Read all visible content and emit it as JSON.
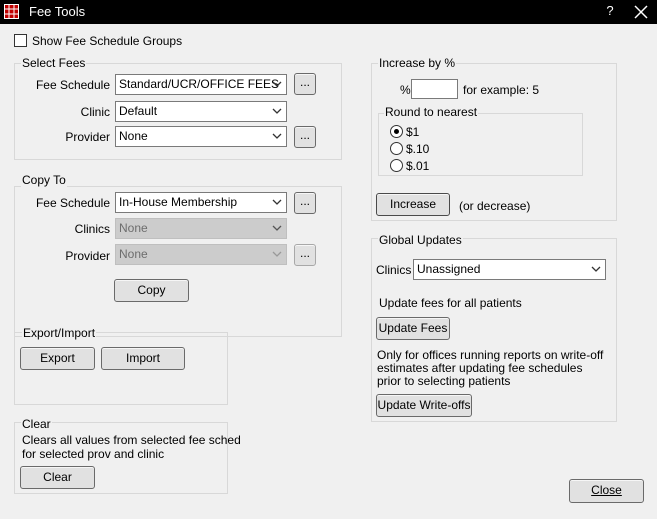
{
  "window": {
    "title": "Fee Tools",
    "help_glyph": "?",
    "close_icon": "close-icon"
  },
  "top": {
    "show_groups_label": "Show Fee Schedule Groups",
    "show_groups_checked": false
  },
  "select_fees": {
    "title": "Select Fees",
    "fee_schedule_label": "Fee Schedule",
    "fee_schedule_value": "Standard/UCR/OFFICE FEES",
    "clinic_label": "Clinic",
    "clinic_value": "Default",
    "provider_label": "Provider",
    "provider_value": "None",
    "ellipsis": "..."
  },
  "copy_to": {
    "title": "Copy To",
    "fee_schedule_label": "Fee Schedule",
    "fee_schedule_value": "In-House Membership",
    "clinics_label": "Clinics",
    "clinics_value": "None",
    "provider_label": "Provider",
    "provider_value": "None",
    "ellipsis": "...",
    "copy_button": "Copy"
  },
  "export_import": {
    "title": "Export/Import",
    "export_button": "Export",
    "import_button": "Import"
  },
  "clear": {
    "title": "Clear",
    "description_line1": "Clears all values from selected fee sched",
    "description_line2": "for selected prov and clinic",
    "clear_button": "Clear"
  },
  "increase": {
    "title": "Increase by %",
    "percent_label": "%",
    "percent_value": "",
    "example_text": "for example: 5",
    "round_title": "Round to nearest",
    "round_options": [
      "$1",
      "$.10",
      "$.01"
    ],
    "round_selected": "$1",
    "increase_button": "Increase",
    "or_decrease": "(or decrease)"
  },
  "global_updates": {
    "title": "Global Updates",
    "clinics_label": "Clinics",
    "clinics_value": "Unassigned",
    "update_fees_text": "Update fees for all patients",
    "update_fees_button": "Update Fees",
    "writeoff_text_line1": "Only for offices running reports on write-off",
    "writeoff_text_line2": "estimates after updating fee schedules",
    "writeoff_text_line3": "prior to selecting patients",
    "update_writeoffs_button": "Update Write-offs"
  },
  "footer": {
    "close_button": "Close"
  }
}
